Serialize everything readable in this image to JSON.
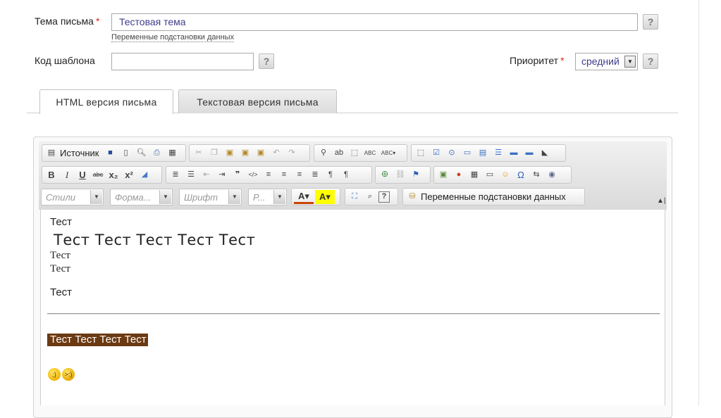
{
  "form": {
    "subject_label": "Тема письма",
    "required_mark": "*",
    "subject_value": "Тестовая тема",
    "help_symbol": "?",
    "vars_link": "Переменные подстановки данных",
    "template_code_label": "Код шаблона",
    "template_code_value": "",
    "priority_label": "Приоритет",
    "priority_value": "средний"
  },
  "tabs": [
    {
      "label": "HTML версия письма",
      "active": true
    },
    {
      "label": "Текстовая версия письма",
      "active": false
    }
  ],
  "toolbar": {
    "source_label": "Источник",
    "styles_placeholder": "Стили",
    "format_placeholder": "Форма...",
    "font_placeholder": "Шрифт",
    "size_placeholder": "Р...",
    "vars_button_label": "Переменные подстановки данных",
    "bold": "B",
    "italic": "I",
    "underline": "U",
    "strike": "abc",
    "subscript": "x₂",
    "superscript": "x²",
    "font_color": "A",
    "bg_color": "A",
    "help": "?",
    "collapse": "▲|",
    "colors": {
      "text_color_accent": "#cc4400",
      "bg_color_accent": "#ffff00"
    }
  },
  "content": {
    "line1": "Тест",
    "line2": "Тест Тест Тест Тест Тест",
    "line3": "Тест",
    "line4": "Тест",
    "line5": "Тест",
    "highlighted": "Тест Тест Тест Тест",
    "highlight_color": "#6b3a12",
    "smileys": [
      "smiley-wink-icon",
      "smiley-devil-icon"
    ]
  }
}
